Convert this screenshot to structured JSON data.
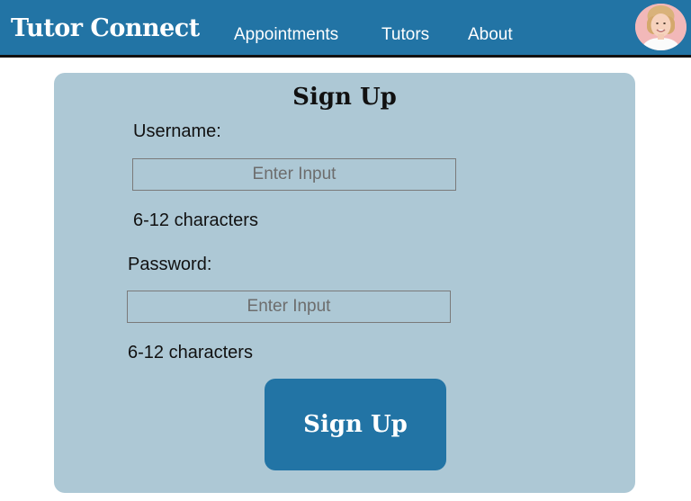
{
  "header": {
    "brand": "Tutor Connect",
    "nav": [
      {
        "label": "Appointments"
      },
      {
        "label": "Tutors"
      },
      {
        "label": "About"
      }
    ],
    "avatar_icon": "user-avatar-photo"
  },
  "signup": {
    "title": "Sign Up",
    "username": {
      "label": "Username:",
      "placeholder": "Enter Input",
      "value": "",
      "hint": "6-12 characters"
    },
    "password": {
      "label": "Password:",
      "placeholder": "Enter Input",
      "value": "",
      "hint": "6-12 characters"
    },
    "submit_label": "Sign Up"
  },
  "colors": {
    "primary": "#2274a5",
    "card_background": "#adc8d5",
    "page_background": "#ffffff"
  }
}
